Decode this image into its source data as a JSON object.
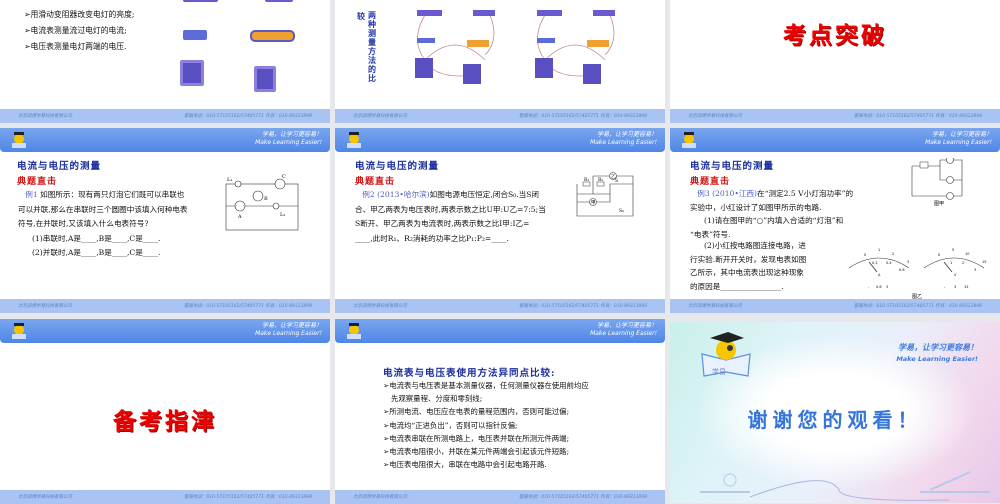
{
  "common": {
    "slogan_cn": "学易，让学习更容易！",
    "slogan_en": "Make Learning Easier!",
    "footer_company": "北京润博学易科技有限公司",
    "footer_contact": "客服电话：010-57105162/57405771    传真：010-89313898"
  },
  "slide1": {
    "bullets": [
      "➢用滑动变阻器改变电灯的亮度;",
      "➢电流表测量流过电灯的电流;",
      "➢电压表测量电灯两端的电压."
    ]
  },
  "slide2": {
    "label_a": "较",
    "label_b": "两种测量方法的比"
  },
  "slide3": {
    "title": "考点突破"
  },
  "slide4": {
    "title": "电流与电压的测量",
    "subtitle": "典题直击",
    "example": "例1",
    "lines": [
      "如图所示：现有两只灯泡它们既可以串联也",
      "可以并联,那么在串联时三个圆圈中该填入何种电表",
      "符号,在并联时,又该填入什么电表符号?"
    ],
    "q1": "(1)串联时,A是____,B是____,C是____.",
    "q2": "(2)并联时,A是____,B是____,C是____.",
    "diagram_labels": [
      "L₁",
      "C",
      "B",
      "A",
      "L₂"
    ]
  },
  "slide5": {
    "title": "电流与电压的测量",
    "subtitle": "典题直击",
    "example": "例2 (2013•哈尔滨)",
    "lines": [
      "如图电源电压恒定,闭合S₀.当S闭",
      "合、甲乙两表为电压表时,两表示数之比U甲:U乙=7:5;当",
      "S断开、甲乙两表为电流表时,两表示数之比I甲:I乙=",
      "____,此时R₁、R₂消耗的功率之比P₁:P₂=____."
    ],
    "diagram_labels": [
      "乙",
      "R₁",
      "R₂",
      "S",
      "甲",
      "S₀"
    ]
  },
  "slide6": {
    "title": "电流与电压的测量",
    "subtitle": "典题直击",
    "example": "例3 (2010•江西)",
    "lines": [
      "在“测定2.5 V小灯泡功率”的",
      "实验中，小红设计了如图甲所示的电路.",
      "(1)请在图甲的“○”内填入合适的“灯泡”和",
      "“电表”符号."
    ],
    "lines2": [
      "(2)小红按电路图连接电路，进",
      "行实验.断开开关时，发现电表如图",
      "乙所示，其中电流表出现这种现象",
      "的原因是________________."
    ],
    "fig_a": "图甲",
    "fig_b": "图乙",
    "meter_a": {
      "unit": "A",
      "ticks": [
        "0",
        "1",
        "2",
        "3",
        "0.2",
        "0.4",
        "0.6"
      ],
      "terminals": [
        "-",
        "0.6",
        "3"
      ]
    },
    "meter_v": {
      "unit": "V",
      "ticks": [
        "0",
        "5",
        "10",
        "15",
        "1",
        "2",
        "3"
      ],
      "terminals": [
        "-",
        "3",
        "15"
      ]
    }
  },
  "slide7": {
    "title": "备考指津"
  },
  "slide8": {
    "title": "电流表与电压表使用方法异同点比较:",
    "bullets": [
      "➢电流表与电压表是基本测量仪器，任何测量仪器在使用前均应",
      "   先观察量程、分度和零刻线;",
      "➢所测电流、电压应在电表的量程范围内，否则可能过偏;",
      "➢电流均“正进负出”，否则可以指针反偏;",
      "➢电流表串联在所测电路上，电压表并联在所测元件两端;",
      "➢电流表电阻很小，并联在某元件两端会引起该元件短路;",
      "➢电压表电阻很大，串联在电路中会引起电路开路."
    ]
  },
  "slide9": {
    "thanks": "谢谢您的观看！",
    "slogan_cn": "学易，让学习更容易！",
    "slogan_en": "Make Learning Easier!",
    "logo_text": "学易"
  }
}
